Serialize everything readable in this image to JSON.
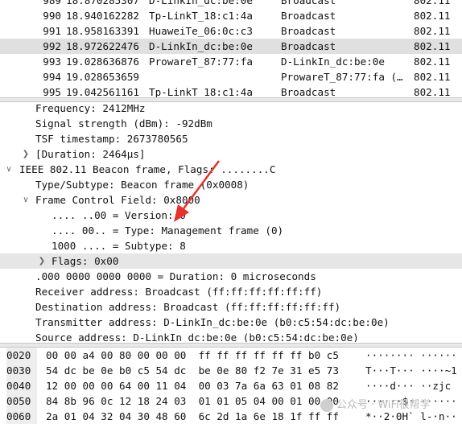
{
  "packet_list": {
    "rows": [
      {
        "no": "989",
        "time": "18.870285307",
        "src": "D-LinkIn_dc:be:0e",
        "dst": "Broadcast",
        "proto": "802.11"
      },
      {
        "no": "990",
        "time": "18.940162282",
        "src": "Tp-LinkT_18:c1:4a",
        "dst": "Broadcast",
        "proto": "802.11"
      },
      {
        "no": "991",
        "time": "18.958163391",
        "src": "HuaweiTe_06:0c:c3",
        "dst": "Broadcast",
        "proto": "802.11"
      },
      {
        "no": "992",
        "time": "18.972622476",
        "src": "D-LinkIn_dc:be:0e",
        "dst": "Broadcast",
        "proto": "802.11"
      },
      {
        "no": "993",
        "time": "19.028636876",
        "src": "ProwareT_87:77:fa",
        "dst": "D-LinkIn_dc:be:0e",
        "proto": "802.11"
      },
      {
        "no": "994",
        "time": "19.028653659",
        "src": "",
        "dst": "ProwareT_87:77:fa (…",
        "proto": "802.11"
      },
      {
        "no": "995",
        "time": "19.042561161",
        "src": "Tp-LinkT_18:c1:4a",
        "dst": "Broadcast",
        "proto": "802.11"
      }
    ]
  },
  "details": {
    "frequency": "Frequency: 2412MHz",
    "signal": "Signal strength (dBm): -92dBm",
    "tsf": "TSF timestamp: 2673780565",
    "duration_group": "[Duration: 2464µs]",
    "ieee_header": "IEEE 802.11 Beacon frame, Flags: ........C",
    "type_subtype": "Type/Subtype: Beacon frame (0x0008)",
    "fcf": "Frame Control Field: 0x8000",
    "version": ".... ..00 = Version: 0",
    "type": ".... 00.. = Type: Management frame (0)",
    "subtype": "1000 .... = Subtype: 8",
    "flags": "Flags: 0x00",
    "duration_field": ".000 0000 0000 0000 = Duration: 0 microseconds",
    "receiver": "Receiver address: Broadcast (ff:ff:ff:ff:ff:ff)",
    "destination": "Destination address: Broadcast (ff:ff:ff:ff:ff:ff)",
    "transmitter": "Transmitter address: D-LinkIn_dc:be:0e (b0:c5:54:dc:be:0e)",
    "source": "Source address: D-LinkIn_dc:be:0e (b0:c5:54:dc:be:0e)"
  },
  "hex": {
    "rows": [
      {
        "off": "0020",
        "b1": "00 00 a4 00 80 00 00 00",
        "b2": "ff ff ff ff ff ff b0 c5",
        "ascii": "········ ······"
      },
      {
        "off": "0030",
        "b1": "54 dc be 0e b0 c5 54 dc",
        "b2": "be 0e 80 f2 7e 31 e5 73",
        "ascii": "T···T··· ····~1"
      },
      {
        "off": "0040",
        "b1": "12 00 00 00 64 00 11 04",
        "b2": "00 03 7a 6a 63 01 08 82",
        "ascii": "····d··· ··zjc"
      },
      {
        "off": "0050",
        "b1": "84 8b 96 0c 12 18 24 03",
        "b2": "01 01 05 04 00 01 00 00",
        "ascii": "······$· ······"
      },
      {
        "off": "0060",
        "b1": "2a 01 04 32 04 30 48 60",
        "b2": "6c 2d 1a 6e 18 1f ff ff",
        "ascii": "*··2·0H` l-·n··"
      }
    ]
  },
  "watermark": "公众号 · WiFi很帮学"
}
